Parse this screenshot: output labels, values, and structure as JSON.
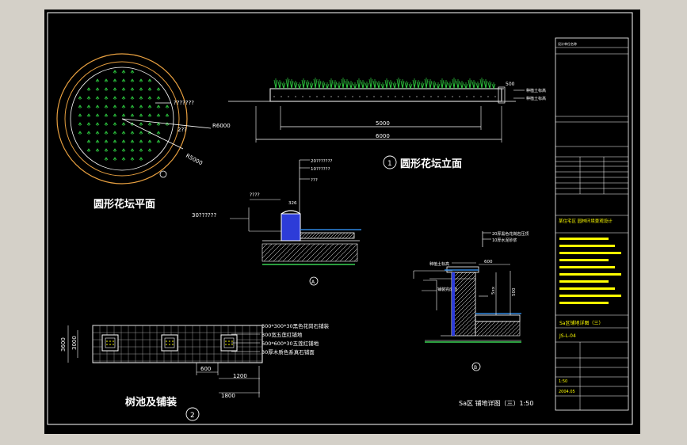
{
  "colors": {
    "canvas": "#d4d0c8",
    "sheet": "#000000",
    "line": "#ffffff",
    "planting": "#2ecc40",
    "ring": "#e8a040",
    "fill_blue": "#2d3cd8",
    "accent_yellow": "#ffff00",
    "dim": "#d9d9d9"
  },
  "plan_view": {
    "title": "圆形花坛平面",
    "label_top": "???????",
    "label_mid": "2??",
    "radius_outer": "R6000",
    "radius_inner": "R5000"
  },
  "elevation_view": {
    "title": "圆形花坛立面",
    "number": "1",
    "dim_inner": "5000",
    "dim_outer": "6000",
    "dim_height": "500",
    "note_1": "种植土标高",
    "note_2": "种植土标高"
  },
  "section_a": {
    "label_1": "20???????",
    "label_2": "10??????",
    "label_3": "???",
    "label_left_1": "????",
    "label_left_2": "30??????",
    "dim_top": "326",
    "marker": "A"
  },
  "tree_pool": {
    "title": "树池及铺装",
    "number": "2",
    "spec_1": "300*300*30黑色花岗石铺装",
    "spec_2": "300宽五莲红铺地",
    "spec_3": "600*600*30五莲红铺地",
    "spec_4": "30厚木质色系真石铺面",
    "dim_height_outer": "3600",
    "dim_height_inner": "3000",
    "dim_600": "600",
    "dim_1200": "1200",
    "dim_1800": "1800"
  },
  "section_b": {
    "label_top_1": "20厚黑色花岗岩压顶",
    "label_top_2": "10厚水泥砂浆",
    "label_left_1": "种植土标高",
    "label_left_2": "铺装完成面",
    "dim_600": "600",
    "dim_5xx": "5xx",
    "dim_500": "500",
    "marker": "B"
  },
  "sheet_caption": "Sa区 铺地详图（三）1:50",
  "title_block": {
    "designer": "设计单位名称",
    "project_name": "某住宅区 园林环境景观设计",
    "sheet_title": "Sa区铺地详图（三）",
    "drawing_no": "JS-L-04",
    "scale_label": "1:50",
    "date": "2004.05"
  }
}
